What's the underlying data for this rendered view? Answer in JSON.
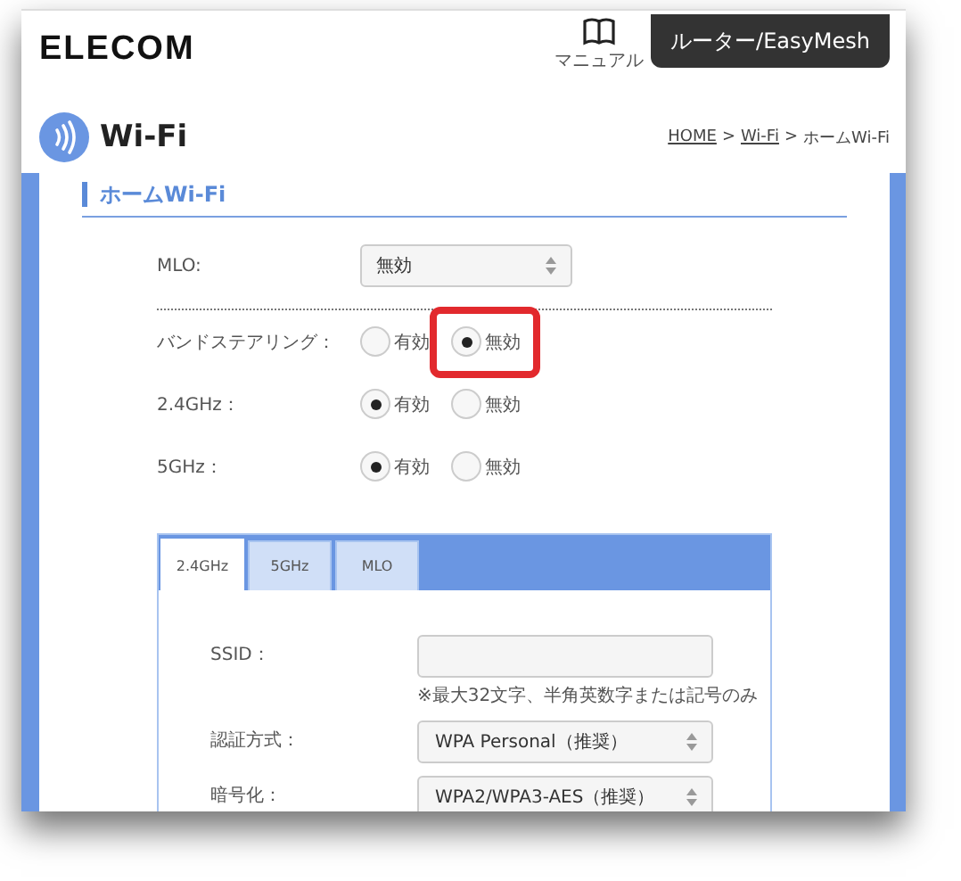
{
  "header": {
    "logo": "ELECOM",
    "manual_label": "マニュアル",
    "router_button": "ルーター/EasyMesh"
  },
  "page": {
    "title": "Wi-Fi",
    "separator": ">",
    "breadcrumb": [
      {
        "text": "HOME",
        "link": true
      },
      {
        "text": "Wi-Fi",
        "link": true
      },
      {
        "text": "ホームWi-Fi",
        "link": false
      }
    ]
  },
  "section_title": "ホームWi-Fi",
  "mlo": {
    "label": "MLO:",
    "value": "無効"
  },
  "radio_rows": [
    {
      "label": "バンドステアリング：",
      "options": [
        {
          "label": "有効",
          "selected": false,
          "highlighted": false
        },
        {
          "label": "無効",
          "selected": true,
          "highlighted": true
        }
      ]
    },
    {
      "label": "2.4GHz：",
      "options": [
        {
          "label": "有効",
          "selected": true,
          "highlighted": false
        },
        {
          "label": "無効",
          "selected": false,
          "highlighted": false
        }
      ]
    },
    {
      "label": "5GHz：",
      "options": [
        {
          "label": "有効",
          "selected": true,
          "highlighted": false
        },
        {
          "label": "無効",
          "selected": false,
          "highlighted": false
        }
      ]
    }
  ],
  "band_tabs": [
    {
      "label": "2.4GHz",
      "selected": true
    },
    {
      "label": "5GHz",
      "selected": false
    },
    {
      "label": "MLO",
      "selected": false
    }
  ],
  "band_fields": [
    {
      "kind": "text",
      "label": "SSID：",
      "hint": "※最大32文字、半角英数字または記号のみ"
    },
    {
      "kind": "select",
      "label": "認証方式：",
      "value": "WPA Personal（推奨）"
    },
    {
      "kind": "select",
      "label": "暗号化：",
      "value": "WPA2/WPA3-AES（推奨）"
    }
  ]
}
